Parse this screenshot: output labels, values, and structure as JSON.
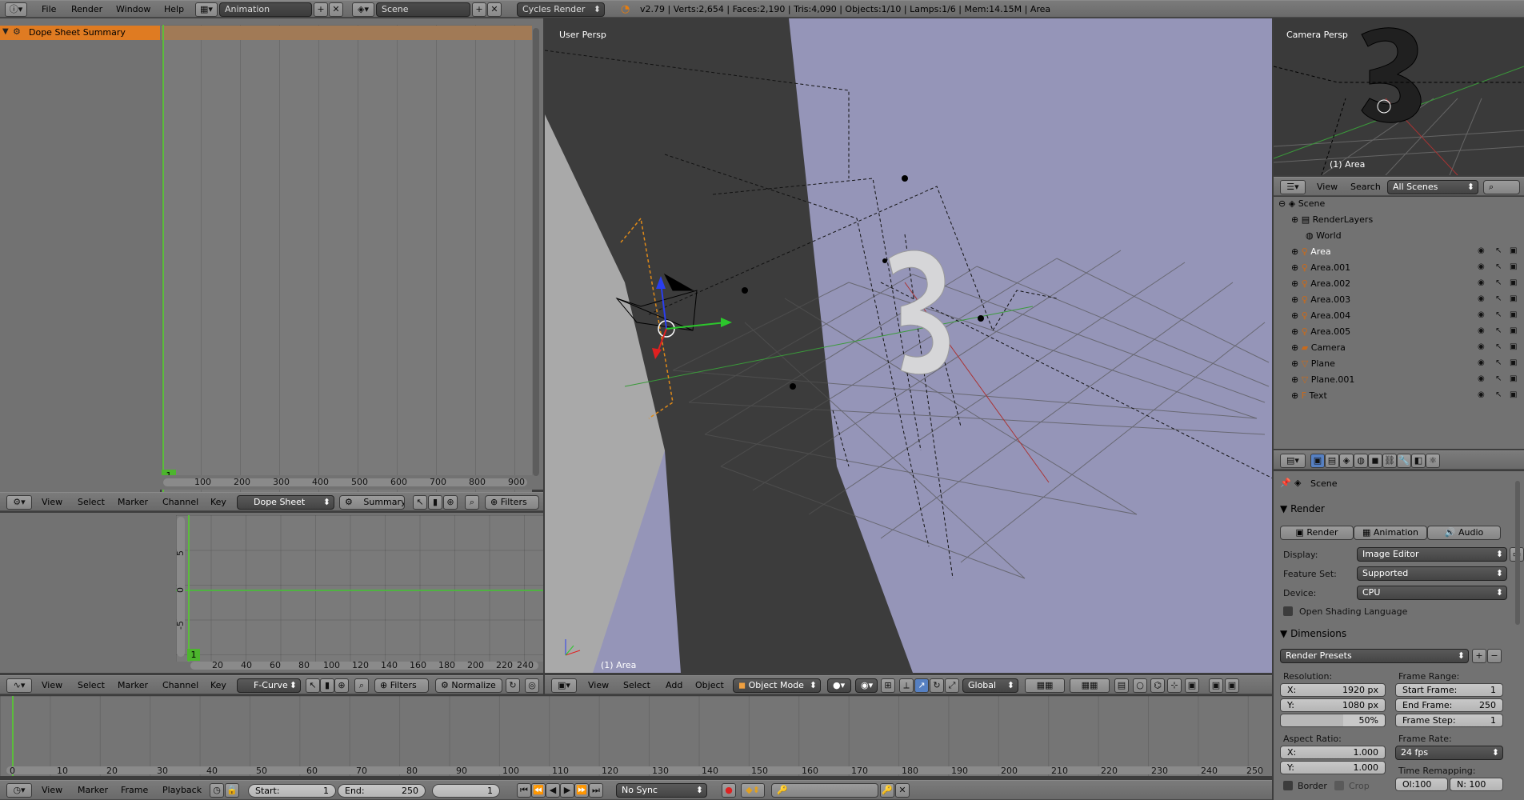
{
  "topbar": {
    "menus": [
      "File",
      "Render",
      "Window",
      "Help"
    ],
    "screen_layout": "Animation",
    "scene": "Scene",
    "engine": "Cycles Render",
    "stats": "v2.79 | Verts:2,654 | Faces:2,190 | Tris:4,090 | Objects:1/10 | Lamps:1/6 | Mem:14.15M | Area"
  },
  "dopesheet": {
    "channel": "Dope Sheet Summary",
    "frame_marker": "1",
    "ticks": [
      "100",
      "200",
      "300",
      "400",
      "500",
      "600",
      "700",
      "800",
      "900"
    ],
    "header": {
      "menus": [
        "View",
        "Select",
        "Marker",
        "Channel",
        "Key"
      ],
      "mode": "Dope Sheet",
      "summary": "Summary",
      "filters": "Filters"
    }
  },
  "fcurve": {
    "yticks": [
      "5",
      "0",
      "-5"
    ],
    "frame_marker": "1",
    "ticks": [
      "20",
      "40",
      "60",
      "80",
      "100",
      "120",
      "140",
      "160",
      "180",
      "200",
      "220",
      "240"
    ],
    "header": {
      "menus": [
        "View",
        "Select",
        "Marker",
        "Channel",
        "Key"
      ],
      "mode": "F-Curve",
      "filters": "Filters",
      "normalize": "Normalize"
    }
  },
  "viewport": {
    "label": "User Persp",
    "object_label": "(1) Area",
    "header": {
      "menus": [
        "View",
        "Select",
        "Add",
        "Object"
      ],
      "mode": "Object Mode",
      "orientation": "Global"
    }
  },
  "camera_view": {
    "label": "Camera Persp",
    "object_label": "(1) Area"
  },
  "outliner": {
    "header": {
      "view": "View",
      "search": "Search",
      "filter": "All Scenes"
    },
    "items": [
      {
        "name": "Scene",
        "indent": 0
      },
      {
        "name": "RenderLayers",
        "indent": 1
      },
      {
        "name": "World",
        "indent": 1
      },
      {
        "name": "Area",
        "indent": 1
      },
      {
        "name": "Area.001",
        "indent": 1
      },
      {
        "name": "Area.002",
        "indent": 1
      },
      {
        "name": "Area.003",
        "indent": 1
      },
      {
        "name": "Area.004",
        "indent": 1
      },
      {
        "name": "Area.005",
        "indent": 1
      },
      {
        "name": "Camera",
        "indent": 1
      },
      {
        "name": "Plane",
        "indent": 1
      },
      {
        "name": "Plane.001",
        "indent": 1
      },
      {
        "name": "Text",
        "indent": 1
      }
    ]
  },
  "properties": {
    "context": "Scene",
    "render_section": "Render",
    "render_buttons": [
      "Render",
      "Animation",
      "Audio"
    ],
    "display_label": "Display:",
    "display_value": "Image Editor",
    "feature_label": "Feature Set:",
    "feature_value": "Supported",
    "device_label": "Device:",
    "device_value": "CPU",
    "osl_label": "Open Shading Language",
    "dimensions_section": "Dimensions",
    "render_presets": "Render Presets",
    "resolution_label": "Resolution:",
    "res_x_label": "X:",
    "res_x": "1920 px",
    "res_y_label": "Y:",
    "res_y": "1080 px",
    "res_pct": "50%",
    "aspect_label": "Aspect Ratio:",
    "aspect_x_label": "X:",
    "aspect_x": "1.000",
    "aspect_y_label": "Y:",
    "aspect_y": "1.000",
    "border_label": "Border",
    "crop_label": "Crop",
    "frame_range_label": "Frame Range:",
    "start_frame_label": "Start Frame:",
    "start_frame": "1",
    "end_frame_label": "End Frame:",
    "end_frame": "250",
    "frame_step_label": "Frame Step:",
    "frame_step": "1",
    "frame_rate_label": "Frame Rate:",
    "frame_rate": "24 fps",
    "time_remap_label": "Time Remapping:",
    "old": "Ol:100",
    "new": "N: 100"
  },
  "timeline": {
    "ticks": [
      "0",
      "10",
      "20",
      "30",
      "40",
      "50",
      "60",
      "70",
      "80",
      "90",
      "100",
      "110",
      "120",
      "130",
      "140",
      "150",
      "160",
      "170",
      "180",
      "190",
      "200",
      "210",
      "220",
      "230",
      "240",
      "250"
    ],
    "header": {
      "menus": [
        "View",
        "Marker",
        "Frame",
        "Playback"
      ],
      "start_label": "Start:",
      "start": "1",
      "end_label": "End:",
      "end": "250",
      "current": "1",
      "sync": "No Sync"
    }
  }
}
